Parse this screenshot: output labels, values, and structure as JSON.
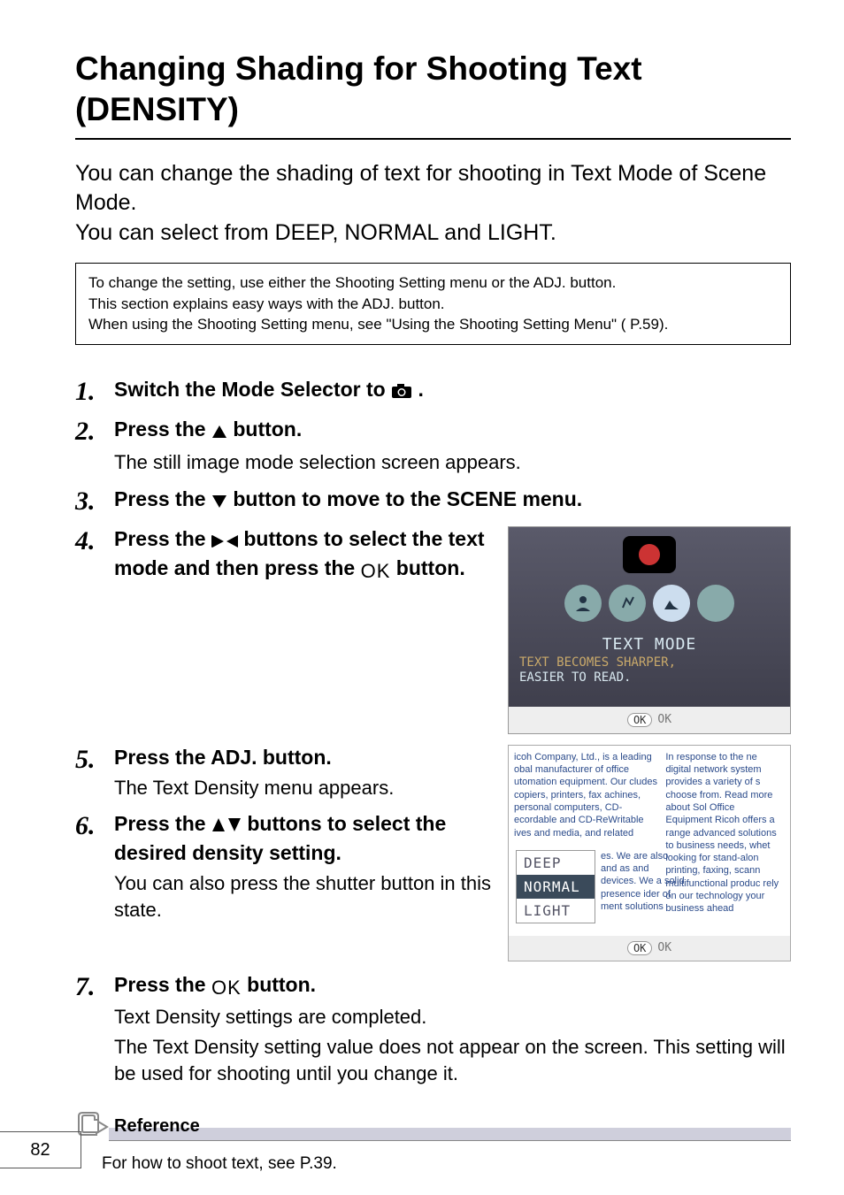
{
  "title": "Changing Shading for Shooting Text (DENSITY)",
  "intro_line1": "You can change the shading of text for shooting in Text Mode of Scene Mode.",
  "intro_line2": "You can select from DEEP, NORMAL and LIGHT.",
  "notebox": {
    "l1": "To change the setting, use either the Shooting Setting menu or the ADJ. button.",
    "l2": "This section explains easy ways with the ADJ. button.",
    "l3": "When using the Shooting Setting menu, see \"Using the Shooting Setting Menu\" ( P.59)."
  },
  "steps": {
    "s1": {
      "num": "1.",
      "head_a": "Switch the Mode Selector to ",
      "head_b": "."
    },
    "s2": {
      "num": "2.",
      "head_a": "Press the ",
      "head_b": " button.",
      "sub": "The still image mode selection screen appears."
    },
    "s3": {
      "num": "3.",
      "head_a": "Press the ",
      "head_b": " button to move to the SCENE menu."
    },
    "s4": {
      "num": "4.",
      "head_a": "Press the ",
      "head_b": " buttons to select the text mode and then press the ",
      "head_c": " button."
    },
    "s5": {
      "num": "5.",
      "head": "Press the ADJ. button.",
      "sub": "The Text Density menu appears."
    },
    "s6": {
      "num": "6.",
      "head_a": "Press the ",
      "head_b": " buttons to select the desired density setting.",
      "sub": "You can also press the shutter button in this state."
    },
    "s7": {
      "num": "7.",
      "head_a": "Press the ",
      "head_b": " button.",
      "sub1": "Text Density settings are completed.",
      "sub2": "The Text Density setting value does not appear on the screen. This setting will be used for shooting until you change it."
    }
  },
  "screenshot1": {
    "mode_label": "TEXT MODE",
    "desc_l1": "TEXT BECOMES SHARPER,",
    "desc_l2": "EASIER TO READ.",
    "ok_pill": "OK",
    "ok_text": "OK"
  },
  "screenshot2": {
    "opts": {
      "o1": "DEEP",
      "o2": "NORMAL",
      "o3": "LIGHT"
    },
    "ok_pill": "OK",
    "ok_text": "OK",
    "blue_left": "icoh Company, Ltd., is a leading obal manufacturer of office utomation equipment. Our cludes copiers, printers, fax achines, personal computers, CD-ecordable and CD-ReWritable ives and media, and related",
    "blue_right": "In response to the ne digital network system provides a variety of s choose from. Read more about Sol Office Equipment Ricoh offers a range advanced solutions to business needs, whet looking for stand-alon printing, faxing, scann multifunctional produc rely on our technology your business ahead",
    "side": "es. We are also and as and devices. We a solid presence ider of ment solutions"
  },
  "reference": {
    "title": "Reference",
    "body": "For how to shoot text, see P.39."
  },
  "page_number": "82"
}
